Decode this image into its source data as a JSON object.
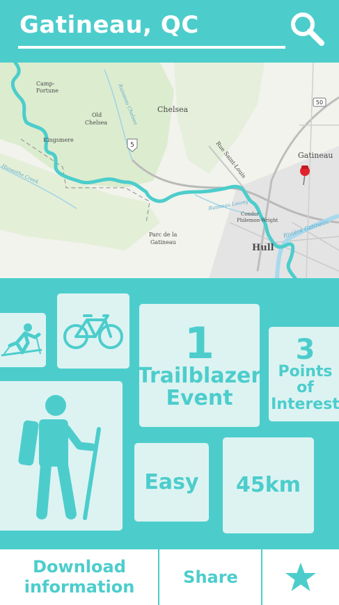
{
  "header": {
    "title": "Gatineau, QC",
    "search_icon": "search-icon"
  },
  "map": {
    "labels": {
      "camp_fortune": [
        "Camp-",
        "Fortune"
      ],
      "old_chelsea": [
        "Old",
        "Chelsea"
      ],
      "kingsmere": "Kingsmere",
      "chelsea": "Chelsea",
      "rue_saint_louis": "Rue Saint-Louis",
      "gatineau": "Gatineau",
      "condor": [
        "Condor",
        "Philemon-Wright"
      ],
      "parc": [
        "Parc de la",
        "Gatineau"
      ],
      "hull": "Hull",
      "riviere": "Rivière Gatineau",
      "ruisseau_chelsea": "Ruisseau Chelsea",
      "ruisseau_leamy": "Ruisseau Leamy",
      "hiawatha": "Hiawatha Creek",
      "route_5": "5",
      "route_50": "50"
    },
    "route_color": "#4ccdcc",
    "pin_color": "#e0232b"
  },
  "stats": {
    "skiing_icon": "cross-country-skiing-icon",
    "cycling_icon": "bicycle-icon",
    "hiking_icon": "hiker-icon",
    "trailblazer_count": "1",
    "trailblazer_label_1": "Trailblazer",
    "trailblazer_label_2": "Event",
    "poi_count": "3",
    "poi_label_1": "Points",
    "poi_label_2": "of",
    "poi_label_3": "Interest",
    "difficulty": "Easy",
    "distance": "45km"
  },
  "footer": {
    "download_1": "Download",
    "download_2": "information",
    "share": "Share",
    "favorite_icon": "star-icon"
  },
  "colors": {
    "accent": "#4ccdcc",
    "tile": "#dcf3f2",
    "white": "#ffffff"
  }
}
